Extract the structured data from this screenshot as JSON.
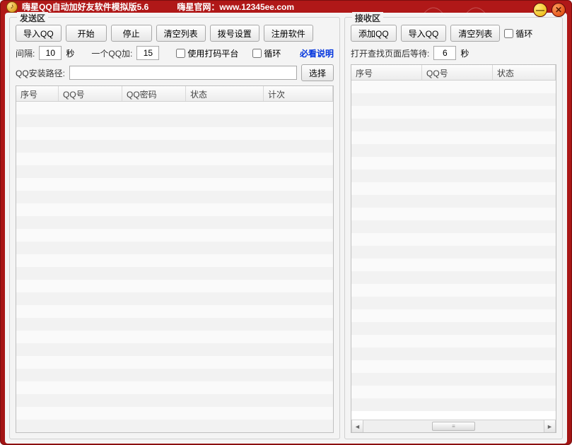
{
  "titlebar": {
    "title": "嗨星QQ自动加好友软件模拟版5.6",
    "site_label": "嗨星官网：",
    "site_url": "www.12345ee.com"
  },
  "send": {
    "panel_title": "发送区",
    "buttons": {
      "import_qq": "导入QQ",
      "start": "开始",
      "stop": "停止",
      "clear_list": "清空列表",
      "dialset": "拨号设置",
      "register": "注册软件"
    },
    "interval_label": "间隔:",
    "interval_value": "10",
    "interval_unit": "秒",
    "perqq_label": "一个QQ加:",
    "perqq_value": "15",
    "use_dama_label": "使用打码平台",
    "loop_label": "循环",
    "mustread": "必看说明",
    "install_path_label": "QQ安装路径:",
    "install_path_value": "",
    "choose_btn": "选择",
    "columns": [
      "序号",
      "QQ号",
      "QQ密码",
      "状态",
      "计次"
    ],
    "rows": []
  },
  "recv": {
    "panel_title": "接收区",
    "buttons": {
      "add_qq": "添加QQ",
      "import_qq": "导入QQ",
      "clear_list": "清空列表"
    },
    "loop_label": "循环",
    "open_wait_label": "打开查找页面后等待:",
    "open_wait_value": "6",
    "open_wait_unit": "秒",
    "columns": [
      "序号",
      "QQ号",
      "状态"
    ],
    "rows": []
  }
}
